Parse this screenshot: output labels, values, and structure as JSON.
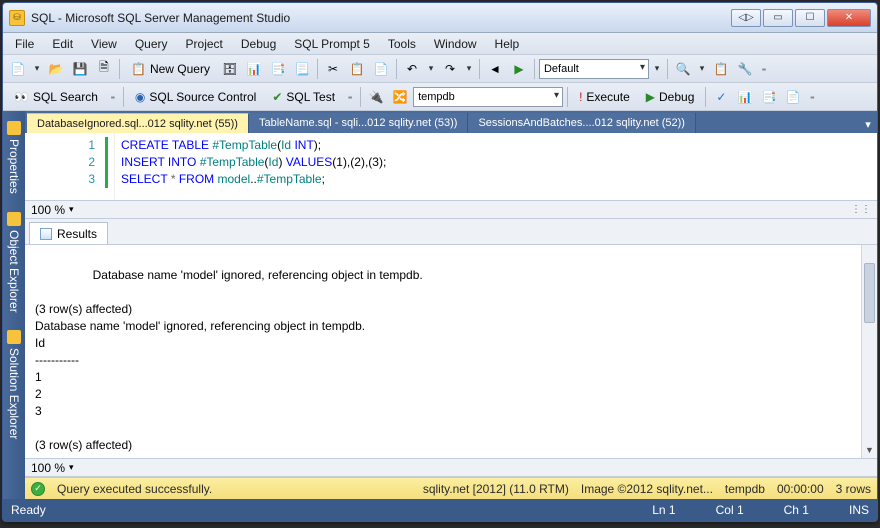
{
  "title": "SQL - Microsoft SQL Server Management Studio",
  "menu": [
    "File",
    "Edit",
    "View",
    "Query",
    "Project",
    "Debug",
    "SQL Prompt 5",
    "Tools",
    "Window",
    "Help"
  ],
  "toolbar1": {
    "new_query": "New Query",
    "config_dropdown": "Default"
  },
  "toolbar2": {
    "sql_search": "SQL Search",
    "sql_source_control": "SQL Source Control",
    "sql_test": "SQL Test",
    "db_dropdown": "tempdb",
    "execute": "Execute",
    "debug": "Debug"
  },
  "sidebar": {
    "tabs": [
      "Properties",
      "Object Explorer",
      "Solution Explorer"
    ]
  },
  "doc_tabs": [
    "DatabaseIgnored.sql...012 sqlity.net (55))",
    "TableName.sql - sqli...012 sqlity.net (53))",
    "SessionsAndBatches....012 sqlity.net (52))"
  ],
  "code": {
    "lines": [
      {
        "n": "1",
        "tokens": [
          [
            "kw",
            "CREATE TABLE"
          ],
          [
            "txt",
            " "
          ],
          [
            "obj",
            "#TempTable"
          ],
          [
            "txt",
            "("
          ],
          [
            "obj",
            "Id"
          ],
          [
            "txt",
            " "
          ],
          [
            "kw",
            "INT"
          ],
          [
            "txt",
            ");"
          ]
        ]
      },
      {
        "n": "2",
        "tokens": [
          [
            "kw",
            "INSERT INTO"
          ],
          [
            "txt",
            " "
          ],
          [
            "obj",
            "#TempTable"
          ],
          [
            "txt",
            "("
          ],
          [
            "obj",
            "Id"
          ],
          [
            "txt",
            ") "
          ],
          [
            "kw",
            "VALUES"
          ],
          [
            "txt",
            "("
          ],
          [
            "num",
            "1"
          ],
          [
            "txt",
            "),("
          ],
          [
            "num",
            "2"
          ],
          [
            "txt",
            "),("
          ],
          [
            "num",
            "3"
          ],
          [
            "txt",
            ");"
          ]
        ]
      },
      {
        "n": "3",
        "tokens": [
          [
            "kw",
            "SELECT"
          ],
          [
            "txt",
            " "
          ],
          [
            "op",
            "*"
          ],
          [
            "txt",
            " "
          ],
          [
            "kw",
            "FROM"
          ],
          [
            "txt",
            " "
          ],
          [
            "obj",
            "model"
          ],
          [
            "txt",
            ".."
          ],
          [
            "obj",
            "#TempTable"
          ],
          [
            "txt",
            ";"
          ]
        ]
      }
    ]
  },
  "zoom": "100 %",
  "results_tab": "Results",
  "results_text": "Database name 'model' ignored, referencing object in tempdb.\n\n(3 row(s) affected)\nDatabase name 'model' ignored, referencing object in tempdb.\nId\n-----------\n1\n2\n3\n\n(3 row(s) affected)",
  "zoom2": "100 %",
  "status": {
    "msg": "Query executed successfully.",
    "server": "sqlity.net [2012] (11.0 RTM)",
    "image": "Image ©2012 sqlity.net...",
    "db": "tempdb",
    "time": "00:00:00",
    "rows": "3 rows"
  },
  "bottom": {
    "ready": "Ready",
    "ln": "Ln 1",
    "col": "Col 1",
    "ch": "Ch 1",
    "ins": "INS"
  }
}
